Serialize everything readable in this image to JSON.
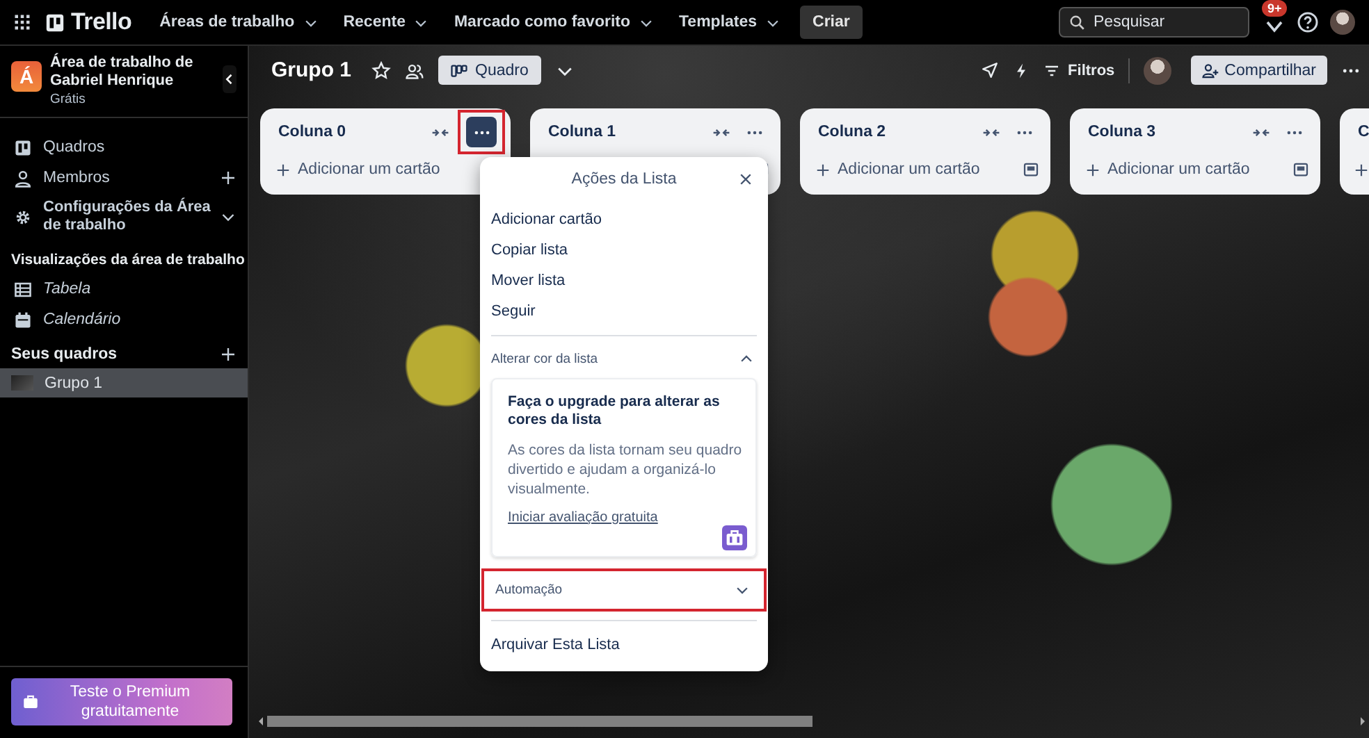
{
  "top_bar": {
    "logo": "Trello",
    "menus": [
      {
        "label": "Áreas de trabalho"
      },
      {
        "label": "Recente"
      },
      {
        "label": "Marcado como favorito"
      },
      {
        "label": "Templates"
      }
    ],
    "create_button": "Criar",
    "search": {
      "placeholder": "Pesquisar"
    },
    "notification_badge": "9+"
  },
  "sidebar": {
    "workspace": {
      "initial": "Á",
      "name": "Área de trabalho de Gabriel Henrique",
      "plan": "Grátis"
    },
    "nav": [
      {
        "label": "Quadros",
        "kind": "link"
      },
      {
        "label": "Membros",
        "kind": "addable"
      },
      {
        "label": "Configurações da Área de trabalho",
        "kind": "expandable"
      }
    ],
    "views_heading": "Visualizações da área de trabalho",
    "views": [
      {
        "label": "Tabela"
      },
      {
        "label": "Calendário"
      }
    ],
    "boards_heading": "Seus quadros",
    "boards": [
      {
        "label": "Grupo 1",
        "selected": true
      }
    ],
    "premium_button": "Teste o Premium gratuitamente"
  },
  "board": {
    "title": "Grupo 1",
    "view_button": "Quadro",
    "filter_button": "Filtros",
    "share_button": "Compartilhar",
    "columns": [
      {
        "kind": "full",
        "title": "Coluna 0",
        "add_label": "Adicionar um cartão",
        "menu_highlighted": true
      },
      {
        "kind": "full",
        "title": "Coluna 1",
        "menu_highlighted": false
      },
      {
        "kind": "full",
        "title": "Coluna 2",
        "add_label": "Adicionar um cartão",
        "menu_highlighted": false
      },
      {
        "kind": "full",
        "title": "Coluna 3",
        "add_label": "Adicionar um cartão",
        "menu_highlighted": false
      },
      {
        "kind": "cut",
        "title": "C"
      }
    ]
  },
  "list_actions": {
    "title": "Ações da Lista",
    "actions": [
      "Adicionar cartão",
      "Copiar lista",
      "Mover lista",
      "Seguir"
    ],
    "color_section": {
      "label": "Alterar cor da lista",
      "expanded": true,
      "upgrade_title": "Faça o upgrade para alterar as cores da lista",
      "upgrade_text": "As cores da lista tornam seu quadro divertido e ajudam a organizá-lo visualmente.",
      "upgrade_link": "Iniciar avaliação gratuita"
    },
    "automation_section": {
      "label": "Automação",
      "expanded": false,
      "highlighted": true
    },
    "archive": "Arquivar Esta Lista"
  }
}
